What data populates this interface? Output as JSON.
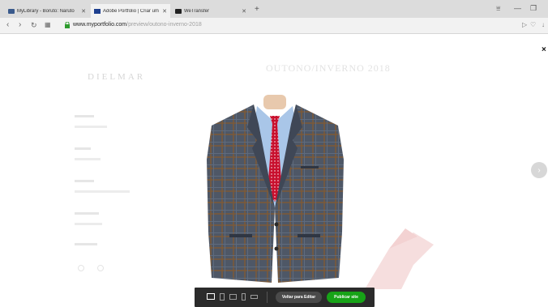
{
  "browser": {
    "tabs": [
      {
        "label": "MyLibrary - Boruto: Naruto",
        "active": false
      },
      {
        "label": "Adobe Portfolio | Criar um",
        "active": true
      },
      {
        "label": "WeTransfer",
        "active": false
      }
    ],
    "url_domain": "www.myportfolio.com",
    "url_path": "/preview/outono-inverno-2018"
  },
  "page": {
    "brand": "DIELMAR",
    "gallery_title": "OUTONO/INVERNO 2018",
    "close_symbol": "×",
    "next_symbol": "›"
  },
  "toolbar": {
    "edit_label": "Voltar para Editar",
    "publish_label": "Publicar site"
  },
  "colors": {
    "publish_green": "#17a317",
    "toolbar_bg": "#2b2b2b"
  }
}
